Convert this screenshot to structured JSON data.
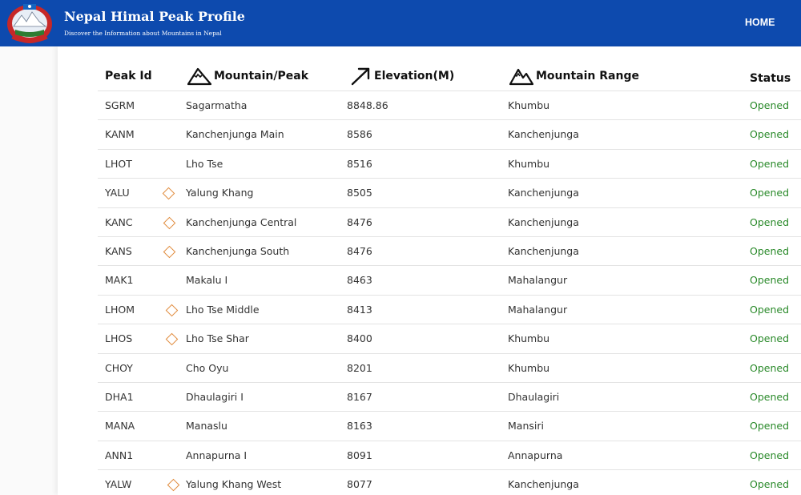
{
  "header": {
    "title": "Nepal Himal Peak Profile",
    "subtitle": "Discover the Information about Mountains in Nepal",
    "nav_home": "HOME",
    "colors": {
      "bar": "#0d4aae",
      "status": "#2a8a2a",
      "marker": "#e08a3a"
    }
  },
  "table": {
    "columns": {
      "id": "Peak Id",
      "name": "Mountain/Peak",
      "elevation": "Elevation(M)",
      "range": "Mountain Range",
      "status": "Status"
    },
    "column_icons": {
      "name": "mountain-icon",
      "elevation": "arrow-up-right-icon",
      "range": "mountain-range-icon"
    },
    "rows": [
      {
        "id": "SGRM",
        "name": "Sagarmatha",
        "elevation": "8848.86",
        "range": "Khumbu",
        "status": "Opened",
        "marker": false
      },
      {
        "id": "KANM",
        "name": "Kanchenjunga Main",
        "elevation": "8586",
        "range": "Kanchenjunga",
        "status": "Opened",
        "marker": false
      },
      {
        "id": "LHOT",
        "name": "Lho Tse",
        "elevation": "8516",
        "range": "Khumbu",
        "status": "Opened",
        "marker": false
      },
      {
        "id": "YALU",
        "name": "Yalung Khang",
        "elevation": "8505",
        "range": "Kanchenjunga",
        "status": "Opened",
        "marker": true
      },
      {
        "id": "KANC",
        "name": "Kanchenjunga Central",
        "elevation": "8476",
        "range": "Kanchenjunga",
        "status": "Opened",
        "marker": true
      },
      {
        "id": "KANS",
        "name": "Kanchenjunga South",
        "elevation": "8476",
        "range": "Kanchenjunga",
        "status": "Opened",
        "marker": true
      },
      {
        "id": "MAK1",
        "name": "Makalu I",
        "elevation": "8463",
        "range": "Mahalangur",
        "status": "Opened",
        "marker": false
      },
      {
        "id": "LHOM",
        "name": "Lho Tse Middle",
        "elevation": "8413",
        "range": "Mahalangur",
        "status": "Opened",
        "marker": true
      },
      {
        "id": "LHOS",
        "name": "Lho Tse Shar",
        "elevation": "8400",
        "range": "Khumbu",
        "status": "Opened",
        "marker": true
      },
      {
        "id": "CHOY",
        "name": "Cho Oyu",
        "elevation": "8201",
        "range": "Khumbu",
        "status": "Opened",
        "marker": false
      },
      {
        "id": "DHA1",
        "name": "Dhaulagiri I",
        "elevation": "8167",
        "range": "Dhaulagiri",
        "status": "Opened",
        "marker": false
      },
      {
        "id": "MANA",
        "name": "Manaslu",
        "elevation": "8163",
        "range": "Mansiri",
        "status": "Opened",
        "marker": false
      },
      {
        "id": "ANN1",
        "name": "Annapurna I",
        "elevation": "8091",
        "range": "Annapurna",
        "status": "Opened",
        "marker": false
      },
      {
        "id": "YALW",
        "name": "Yalung Khang West",
        "elevation": "8077",
        "range": "Kanchenjunga",
        "status": "Opened",
        "marker": true
      }
    ]
  }
}
